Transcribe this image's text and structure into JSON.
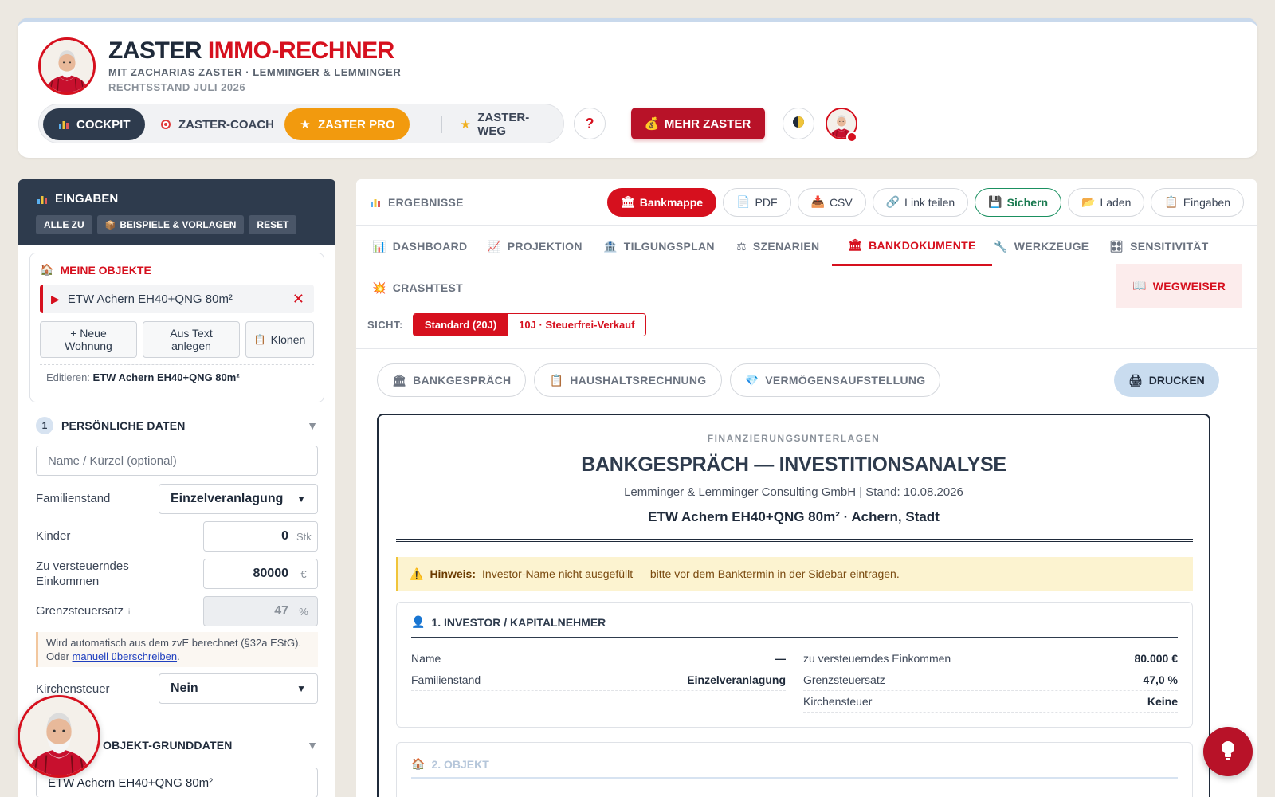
{
  "header": {
    "title_part1": "ZASTER",
    "title_part2": "IMMO-RECHNER",
    "subtitle": "MIT ZACHARIAS ZASTER · LEMMINGER & LEMMINGER",
    "legal_state": "RECHTSSTAND JULI 2026",
    "nav": [
      {
        "label": "COCKPIT",
        "icon": "bar-chart-icon",
        "active": true
      },
      {
        "label": "ZASTER-COACH",
        "icon": "target-icon"
      },
      {
        "label": "ZASTER PRO",
        "icon": "star-icon"
      },
      {
        "label": "ZASTER-WEG",
        "icon": "star-outline-icon"
      }
    ],
    "help_label": "?",
    "mehr_label": "MEHR ZASTER"
  },
  "sidebar": {
    "title": "EINGABEN",
    "actions": [
      "ALLE ZU",
      "BEISPIELE & VORLAGEN",
      "RESET"
    ],
    "objects_title": "MEINE OBJEKTE",
    "object_name": "ETW Achern EH40+QNG 80m²",
    "btn_new": "+ Neue Wohnung",
    "btn_text": "Aus Text anlegen",
    "btn_clone": "Klonen",
    "edit_label": "Editieren:",
    "edit_value": "ETW Achern EH40+QNG 80m²",
    "section1_num": "1",
    "section1_title": "PERSÖNLICHE DATEN",
    "name_placeholder": "Name / Kürzel (optional)",
    "familienstand_label": "Familienstand",
    "familienstand_value": "Einzelveranlagung",
    "kinder_label": "Kinder",
    "kinder_value": "0",
    "kinder_unit": "Stk",
    "zve_label": "Zu versteuerndes Einkommen",
    "zve_value": "80000",
    "zve_unit": "€",
    "grenz_label": "Grenzsteuersatz",
    "grenz_info": "i",
    "grenz_value": "47",
    "grenz_unit": "%",
    "notice_text": "Wird automatisch aus dem zvE berechnet (§32a EStG). Oder",
    "notice_link": "manuell überschreiben",
    "kirchen_label": "Kirchensteuer",
    "kirchen_value": "Nein",
    "section2_title": "OBJEKT-GRUNDDATEN",
    "section2_field": "ETW Achern EH40+QNG 80m²"
  },
  "main": {
    "results_title": "ERGEBNISSE",
    "actions": [
      {
        "label": "Bankmappe",
        "icon": "bank-icon",
        "style": "red"
      },
      {
        "label": "PDF",
        "icon": "document-icon"
      },
      {
        "label": "CSV",
        "icon": "tray-icon"
      },
      {
        "label": "Link teilen",
        "icon": "link-icon"
      },
      {
        "label": "Sichern",
        "icon": "floppy-icon",
        "style": "green"
      },
      {
        "label": "Laden",
        "icon": "folder-icon"
      },
      {
        "label": "Eingaben",
        "icon": "clipboard-icon"
      }
    ],
    "tabs": [
      {
        "label": "DASHBOARD",
        "icon": "bar-chart-icon"
      },
      {
        "label": "PROJEKTION",
        "icon": "line-chart-icon"
      },
      {
        "label": "TILGUNGSPLAN",
        "icon": "bank-icon"
      },
      {
        "label": "SZENARIEN",
        "icon": "scales-icon"
      },
      {
        "label": "BANKDOKUMENTE",
        "icon": "bank-icon",
        "active": true
      },
      {
        "label": "WERKZEUGE",
        "icon": "wrench-icon"
      },
      {
        "label": "SENSITIVITÄT",
        "icon": "grid-icon"
      },
      {
        "label": "CRASHTEST",
        "icon": "explosion-icon"
      },
      {
        "label": "WEGWEISER",
        "icon": "book-icon"
      }
    ],
    "sicht_label": "SICHT:",
    "sicht_options": [
      "Standard (20J)",
      "10J · Steuerfrei-Verkauf"
    ],
    "doc_tabs": [
      {
        "label": "BANKGESPRÄCH",
        "icon": "bank-icon"
      },
      {
        "label": "HAUSHALTSRECHNUNG",
        "icon": "clipboard-icon"
      },
      {
        "label": "VERMÖGENSAUFSTELLUNG",
        "icon": "gem-icon"
      }
    ],
    "print_label": "DRUCKEN"
  },
  "document": {
    "kicker": "FINANZIERUNGSUNTERLAGEN",
    "title": "BANKGESPRÄCH — INVESTITIONSANALYSE",
    "meta": "Lemminger & Lemminger Consulting GmbH | Stand: 10.08.2026",
    "object_line": "ETW Achern EH40+QNG 80m² · Achern, Stadt",
    "hint_label": "Hinweis:",
    "hint_text": "Investor-Name nicht ausgefüllt — bitte vor dem Banktermin in der Sidebar eintragen.",
    "section1_title": "1. INVESTOR / KAPITALNEHMER",
    "left_rows": [
      {
        "k": "Name",
        "v": "—"
      },
      {
        "k": "Familienstand",
        "v": "Einzelveranlagung"
      }
    ],
    "right_rows": [
      {
        "k": "zu versteuerndes Einkommen",
        "v": "80.000 €"
      },
      {
        "k": "Grenzsteuersatz",
        "v": "47,0 %"
      },
      {
        "k": "Kirchensteuer",
        "v": "Keine"
      }
    ],
    "section2_title": "2. OBJEKT"
  },
  "colors": {
    "brand_red": "#d6101e",
    "navy": "#2e3b4d",
    "pro_orange": "#f29a0e",
    "mehr_red": "#b81228"
  }
}
